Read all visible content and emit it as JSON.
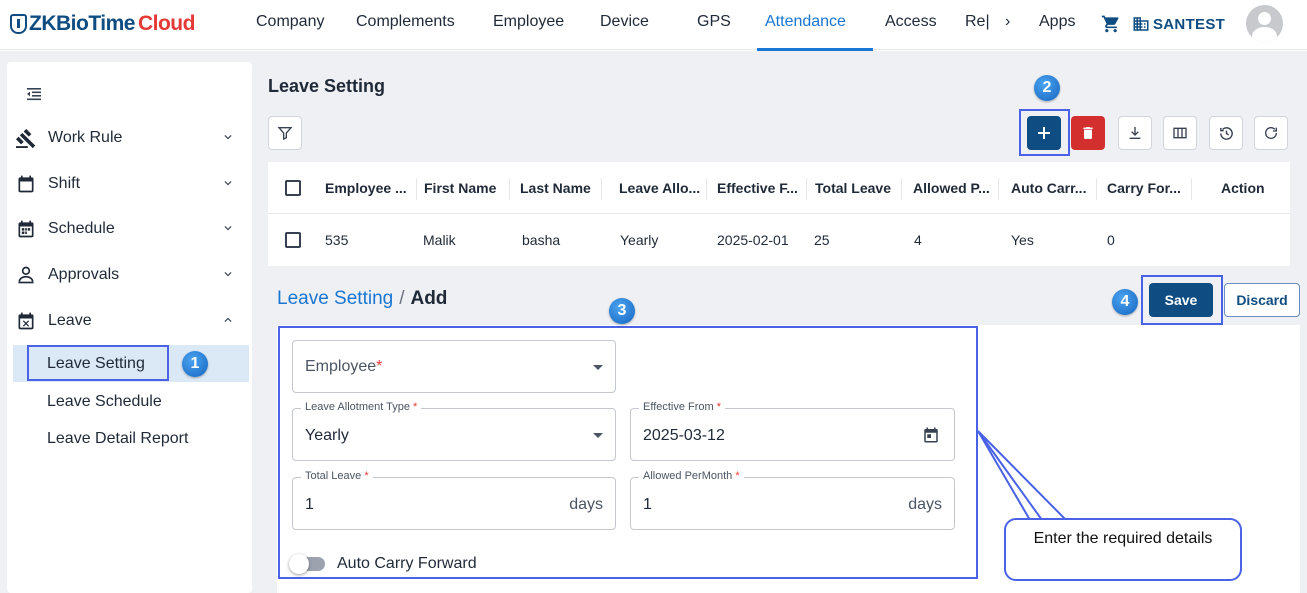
{
  "app": {
    "logo_main": "ZKBioTime",
    "logo_accent": "Cloud"
  },
  "nav": {
    "items": [
      "Company",
      "Complements",
      "Employee",
      "Device",
      "GPS",
      "Attendance",
      "Access",
      "Re|",
      "›",
      "Apps"
    ],
    "active": "Attendance",
    "org_name": "SANTEST"
  },
  "sidebar": {
    "items": [
      {
        "label": "Work Rule",
        "icon": "gavel-icon",
        "expanded": false
      },
      {
        "label": "Shift",
        "icon": "calendar-blank-icon",
        "expanded": false
      },
      {
        "label": "Schedule",
        "icon": "calendar-grid-icon",
        "expanded": false
      },
      {
        "label": "Approvals",
        "icon": "person-approve-icon",
        "expanded": false
      },
      {
        "label": "Leave",
        "icon": "calendar-x-icon",
        "expanded": true
      }
    ],
    "leave_submenu": [
      "Leave Setting",
      "Leave Schedule",
      "Leave Detail Report"
    ],
    "active_submenu": "Leave Setting"
  },
  "leave_setting": {
    "title": "Leave Setting",
    "columns": [
      "Employee ...",
      "First Name",
      "Last Name",
      "Leave Allo...",
      "Effective F...",
      "Total Leave",
      "Allowed P...",
      "Auto Carr...",
      "Carry For...",
      "Action"
    ],
    "rows": [
      [
        "535",
        "Malik",
        "basha",
        "Yearly",
        "2025-02-01",
        "25",
        "4",
        "Yes",
        "0"
      ]
    ]
  },
  "add_form": {
    "breadcrumb_parent": "Leave Setting",
    "breadcrumb_sep": "/",
    "breadcrumb_current": "Add",
    "save_label": "Save",
    "discard_label": "Discard",
    "employee": {
      "placeholder": "Employee",
      "required_mark": "*"
    },
    "allotment_type": {
      "label": "Leave Allotment Type",
      "required_mark": "*",
      "value": "Yearly"
    },
    "effective_from": {
      "label": "Effective From",
      "required_mark": "*",
      "value": "2025-03-12"
    },
    "total_leave": {
      "label": "Total Leave",
      "required_mark": "*",
      "value": "1",
      "suffix": "days"
    },
    "allowed_per_month": {
      "label": "Allowed PerMonth",
      "required_mark": "*",
      "value": "1",
      "suffix": "days"
    },
    "auto_carry": {
      "label": "Auto Carry Forward",
      "enabled": false
    }
  },
  "annotations": {
    "badges": [
      "1",
      "2",
      "3",
      "4"
    ],
    "tooltip": "Enter the required details"
  },
  "colors": {
    "brand_dark": "#0f4c81",
    "accent_blue": "#1976d2",
    "danger": "#d32f2f",
    "highlight": "#4a62e6"
  }
}
